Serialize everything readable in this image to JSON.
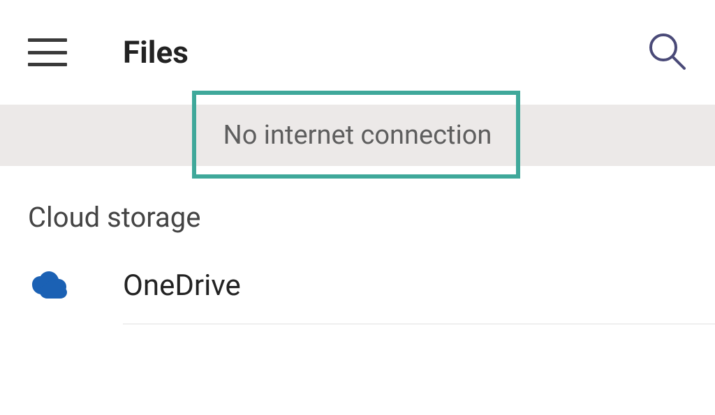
{
  "header": {
    "title": "Files"
  },
  "banner": {
    "message": "No internet connection"
  },
  "section": {
    "title": "Cloud storage",
    "items": [
      {
        "icon": "onedrive",
        "label": "OneDrive"
      }
    ]
  },
  "colors": {
    "highlight": "#3fa89a",
    "onedrive": "#1b61b4"
  }
}
